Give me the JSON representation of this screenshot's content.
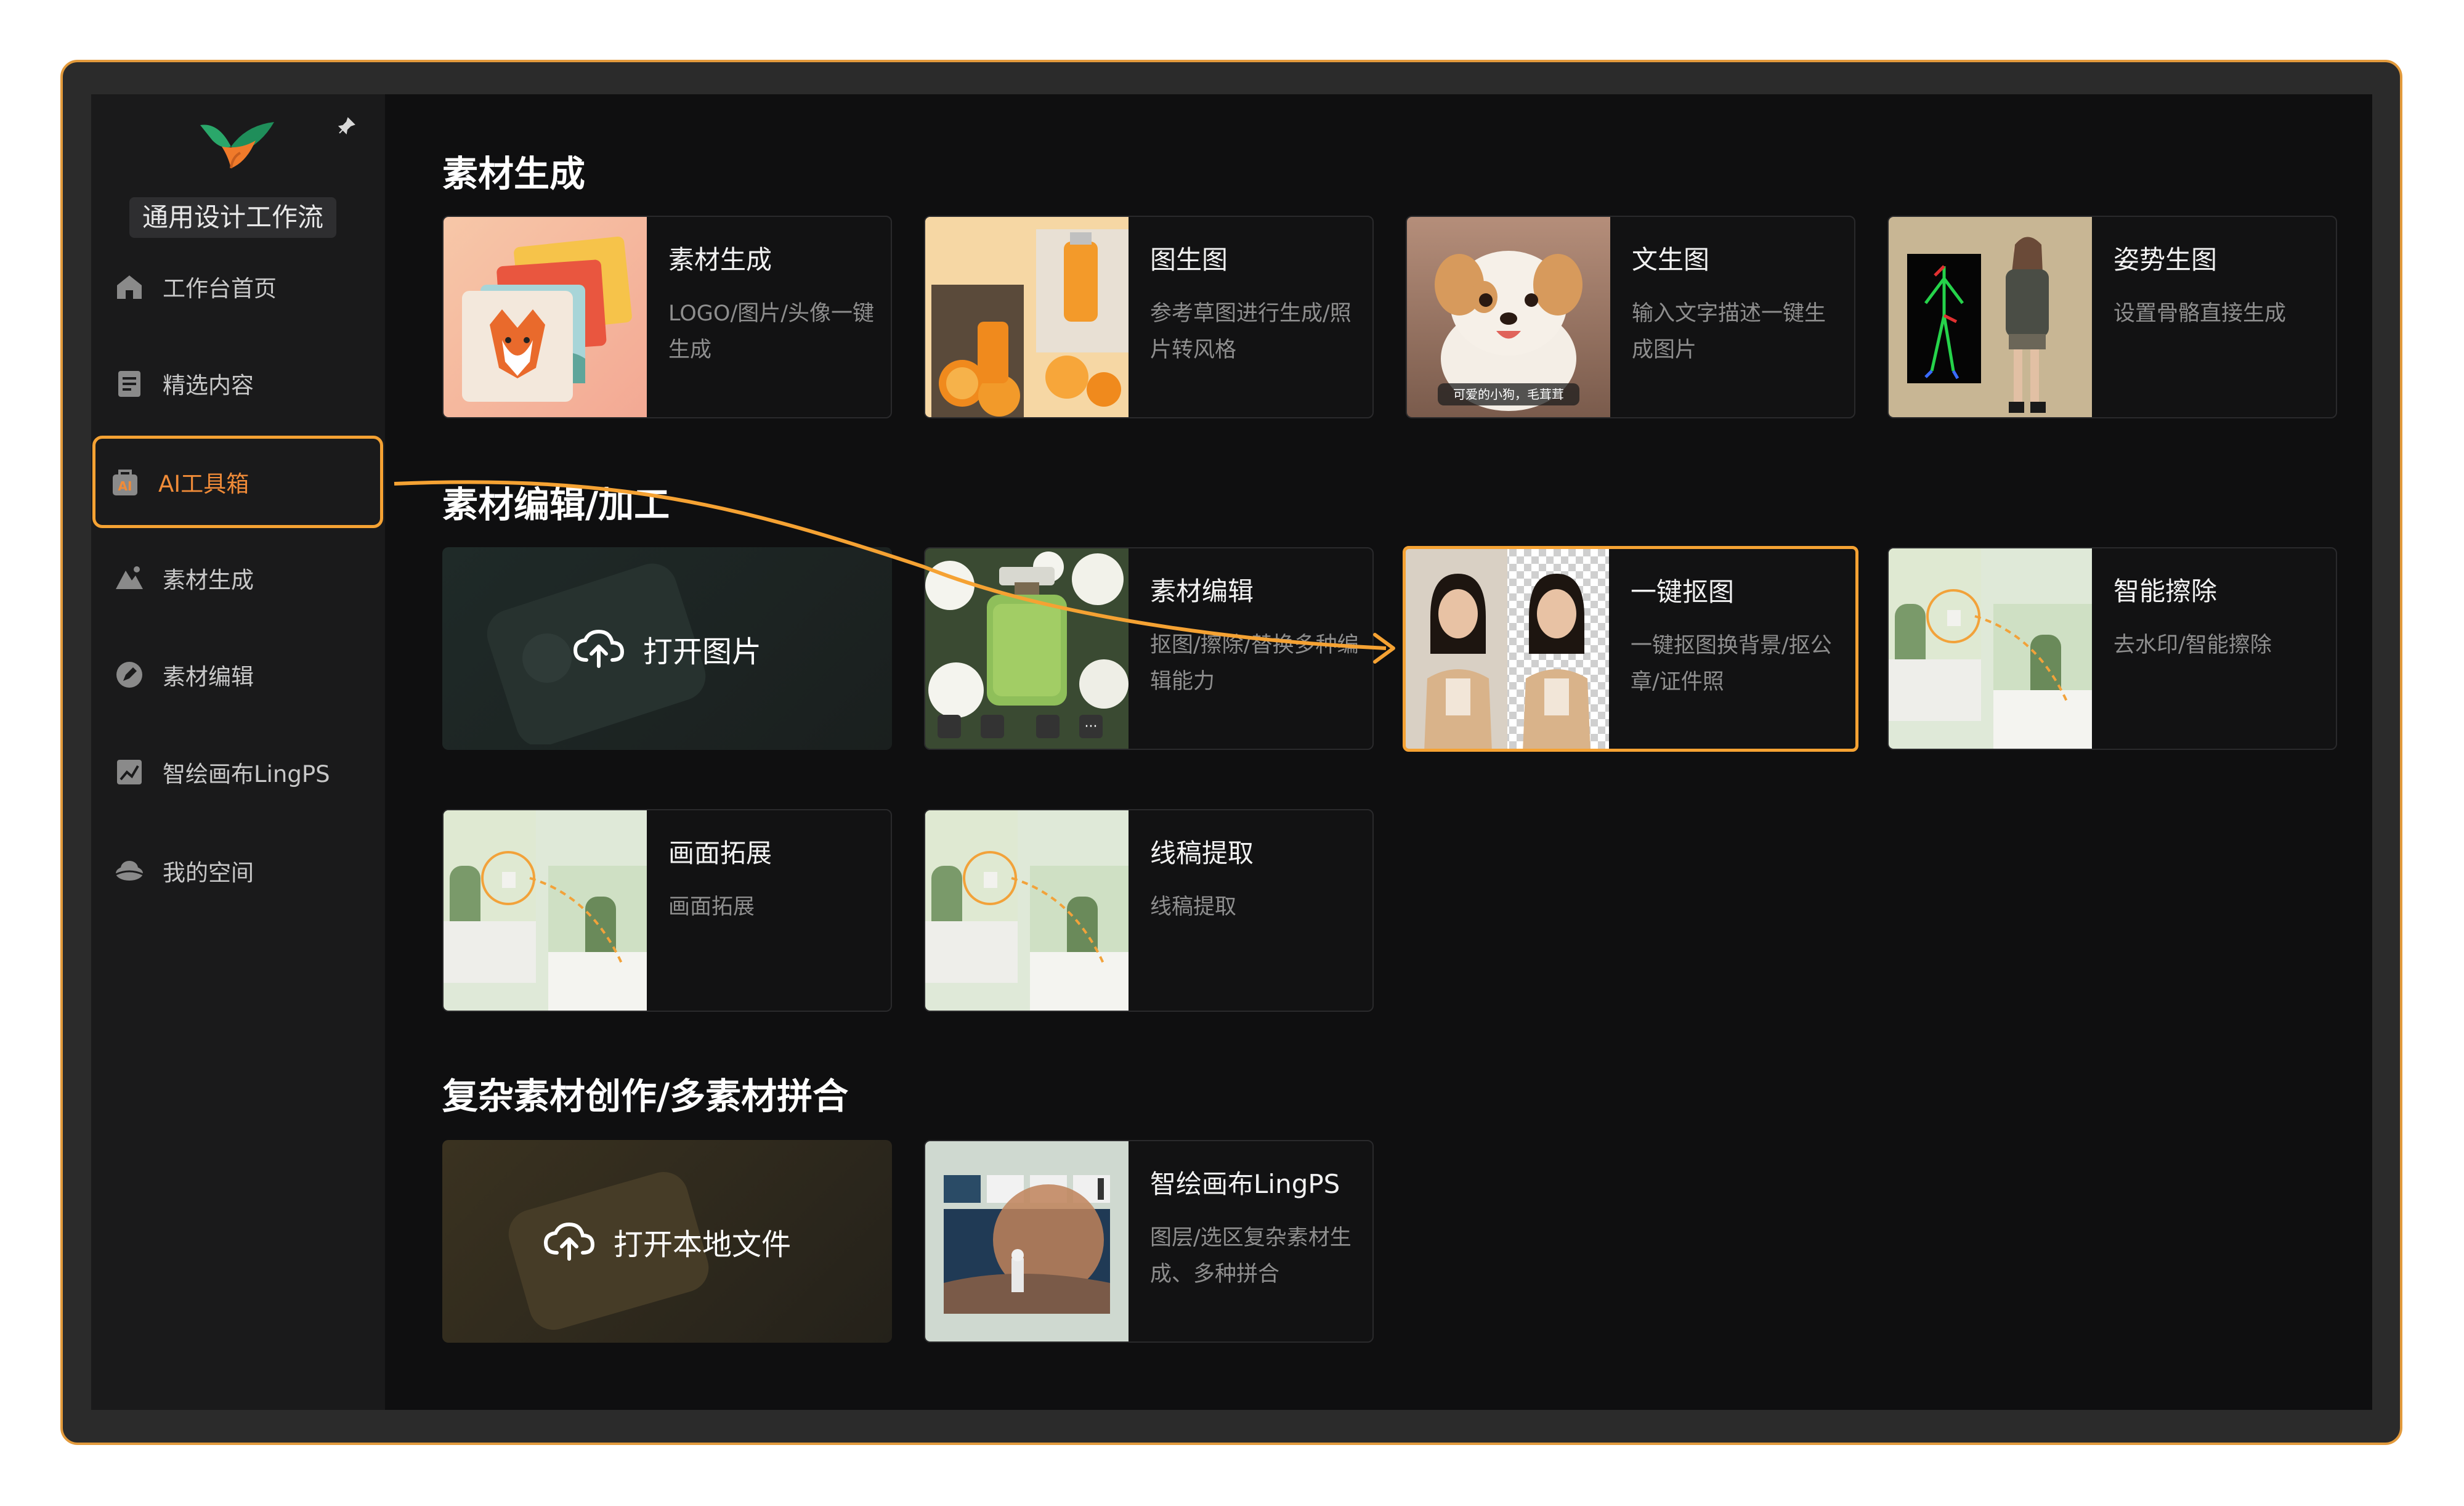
{
  "sidebar": {
    "workflow": "通用设计工作流",
    "items": [
      {
        "label": "工作台首页",
        "icon": "home-icon"
      },
      {
        "label": "精选内容",
        "icon": "document-icon"
      },
      {
        "label": "AI工具箱",
        "icon": "ai-toolbox-icon",
        "active": true
      },
      {
        "label": "素材生成",
        "icon": "mountain-icon"
      },
      {
        "label": "素材编辑",
        "icon": "pen-icon"
      },
      {
        "label": "智绘画布LingPS",
        "icon": "canvas-icon"
      },
      {
        "label": "我的空间",
        "icon": "cloud-space-icon"
      }
    ]
  },
  "sections": [
    {
      "title": "素材生成",
      "cards": [
        {
          "title": "素材生成",
          "desc": "LOGO/图片/头像一键生成"
        },
        {
          "title": "图生图",
          "desc": "参考草图进行生成/照片转风格"
        },
        {
          "title": "文生图",
          "desc": "输入文字描述一键生成图片",
          "caption": "可爱的小狗，毛茸茸"
        },
        {
          "title": "姿势生图",
          "desc": "设置骨骼直接生成"
        }
      ]
    },
    {
      "title": "素材编辑/加工",
      "upload": "打开图片",
      "cards": [
        {
          "title": "素材编辑",
          "desc": "抠图/擦除/替换多种编辑能力"
        },
        {
          "title": "一键抠图",
          "desc": "一键抠图换背景/抠公章/证件照",
          "highlighted": true
        },
        {
          "title": "智能擦除",
          "desc": "去水印/智能擦除"
        },
        {
          "title": "画面拓展",
          "desc": "画面拓展"
        },
        {
          "title": "线稿提取",
          "desc": "线稿提取"
        }
      ]
    },
    {
      "title": "复杂素材创作/多素材拼合",
      "upload": "打开本地文件",
      "cards": [
        {
          "title": "智绘画布LingPS",
          "desc": "图层/选区复杂素材生成、多种拼合"
        }
      ]
    }
  ],
  "colors": {
    "accent": "#f5a233",
    "active_text": "#f08b38",
    "background": "#0f0f10",
    "sidebar": "#1a1a1b"
  }
}
